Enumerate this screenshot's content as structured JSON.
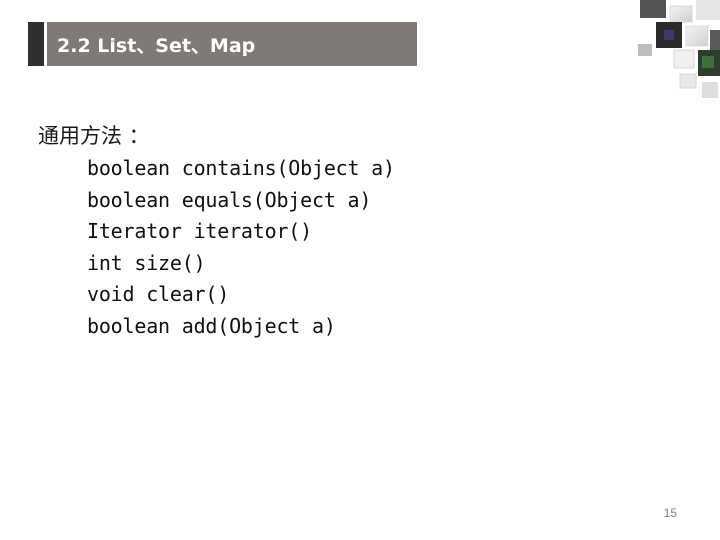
{
  "slide": {
    "title": "2.2 List、Set、Map",
    "heading": "通用方法 ：",
    "code_lines": [
      "boolean contains(Object a)",
      "boolean equals(Object a)",
      "Iterator iterator()",
      "int size()",
      "void clear()",
      "boolean add(Object a)"
    ],
    "page_number": "15"
  },
  "colors": {
    "title_bar": "#7f7a78",
    "title_accent": "#2f2f2f",
    "title_text": "#ffffff"
  }
}
